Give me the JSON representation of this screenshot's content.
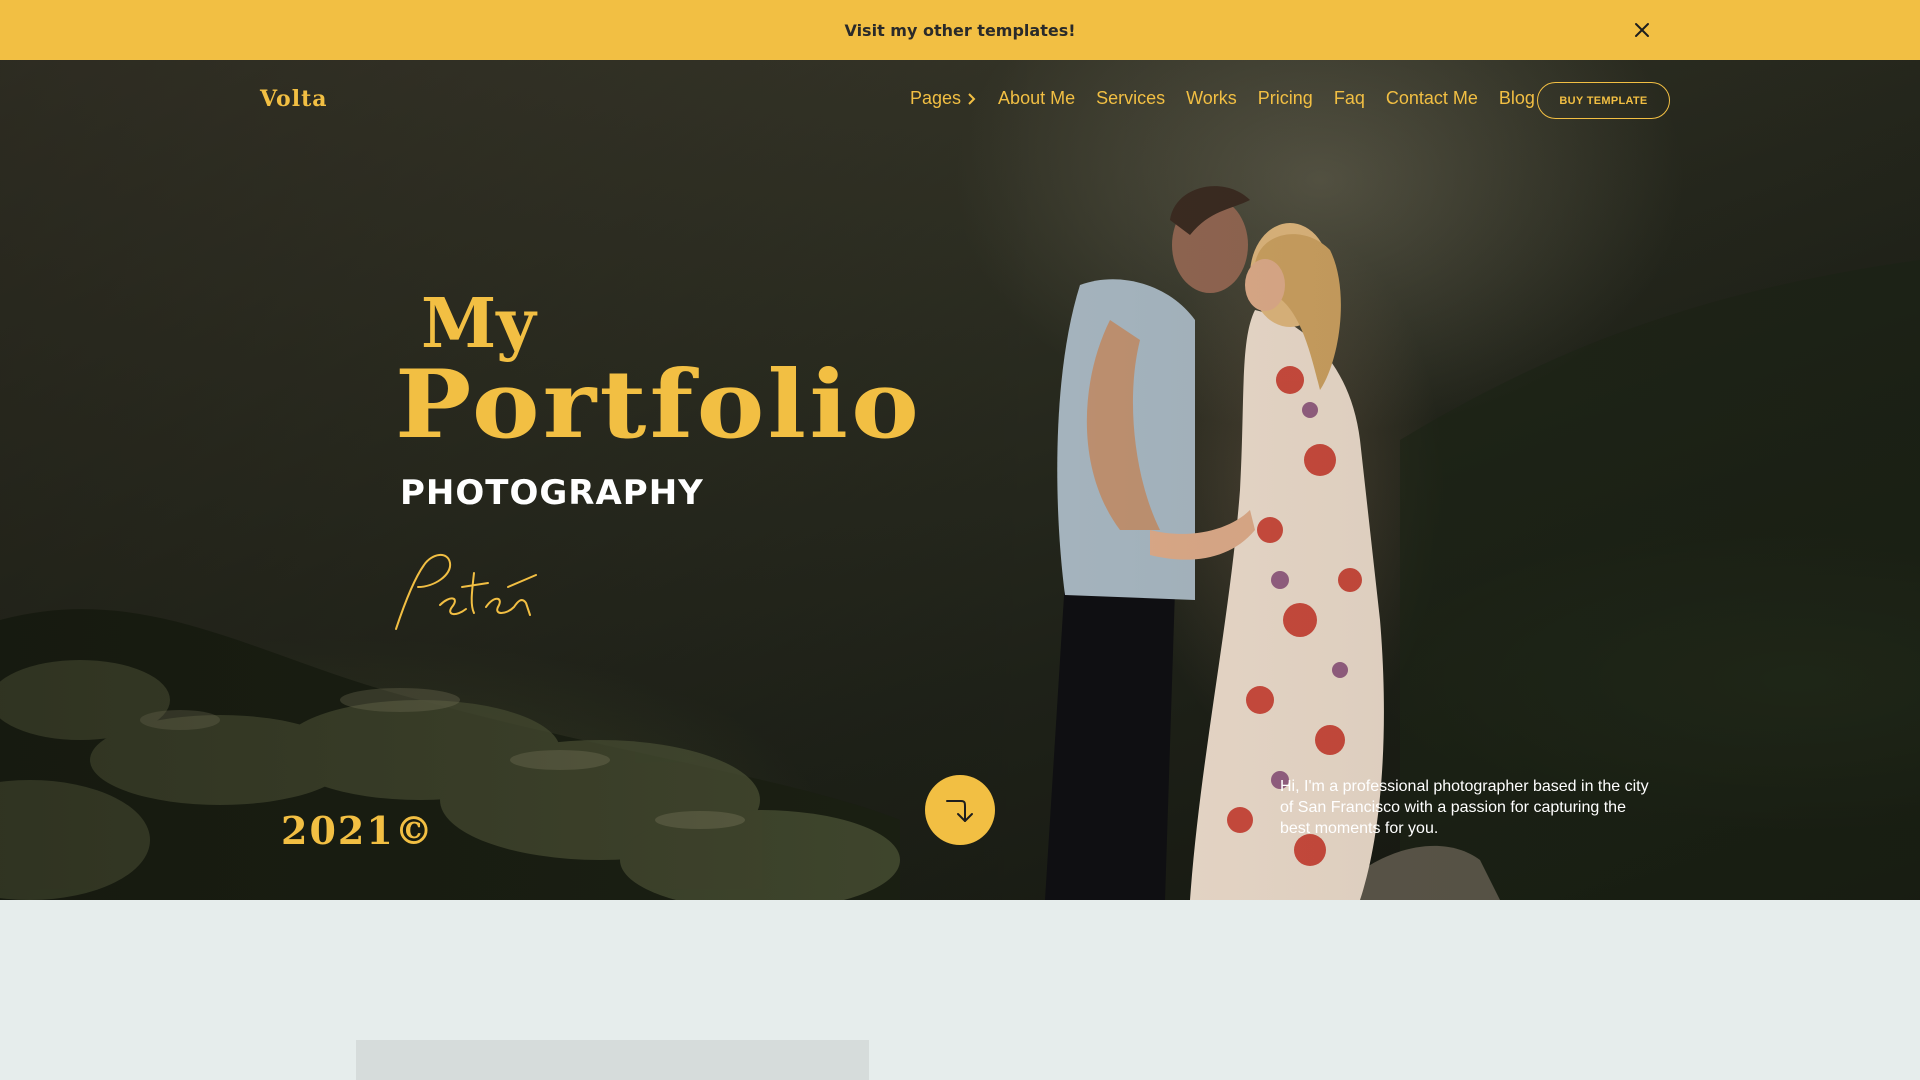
{
  "announcement": {
    "text": "Visit my other templates!",
    "close_icon": "close-icon"
  },
  "header": {
    "logo": "Volta",
    "nav": [
      {
        "label": "Pages",
        "icon": "chevron-right-icon"
      },
      {
        "label": "About Me"
      },
      {
        "label": "Services"
      },
      {
        "label": "Works"
      },
      {
        "label": "Pricing"
      },
      {
        "label": "Faq"
      },
      {
        "label": "Contact Me"
      },
      {
        "label": "Blog"
      }
    ],
    "cta_label": "BUY TEMPLATE"
  },
  "hero": {
    "title_line1": "My",
    "title_line2": "Portfolio",
    "subtitle": "PHOTOGRAPHY",
    "signature": "Peter",
    "year": "2021©",
    "scroll_icon": "arrow-down-right-icon",
    "intro": "Hi, I'm a professional photographer based in the city of San Francisco with a passion for capturing the best moments for you."
  },
  "colors": {
    "accent": "#f2bf43",
    "announcement_bg": "#f2bf43",
    "section_bg": "#e6edec",
    "text_light": "#ffffff"
  }
}
